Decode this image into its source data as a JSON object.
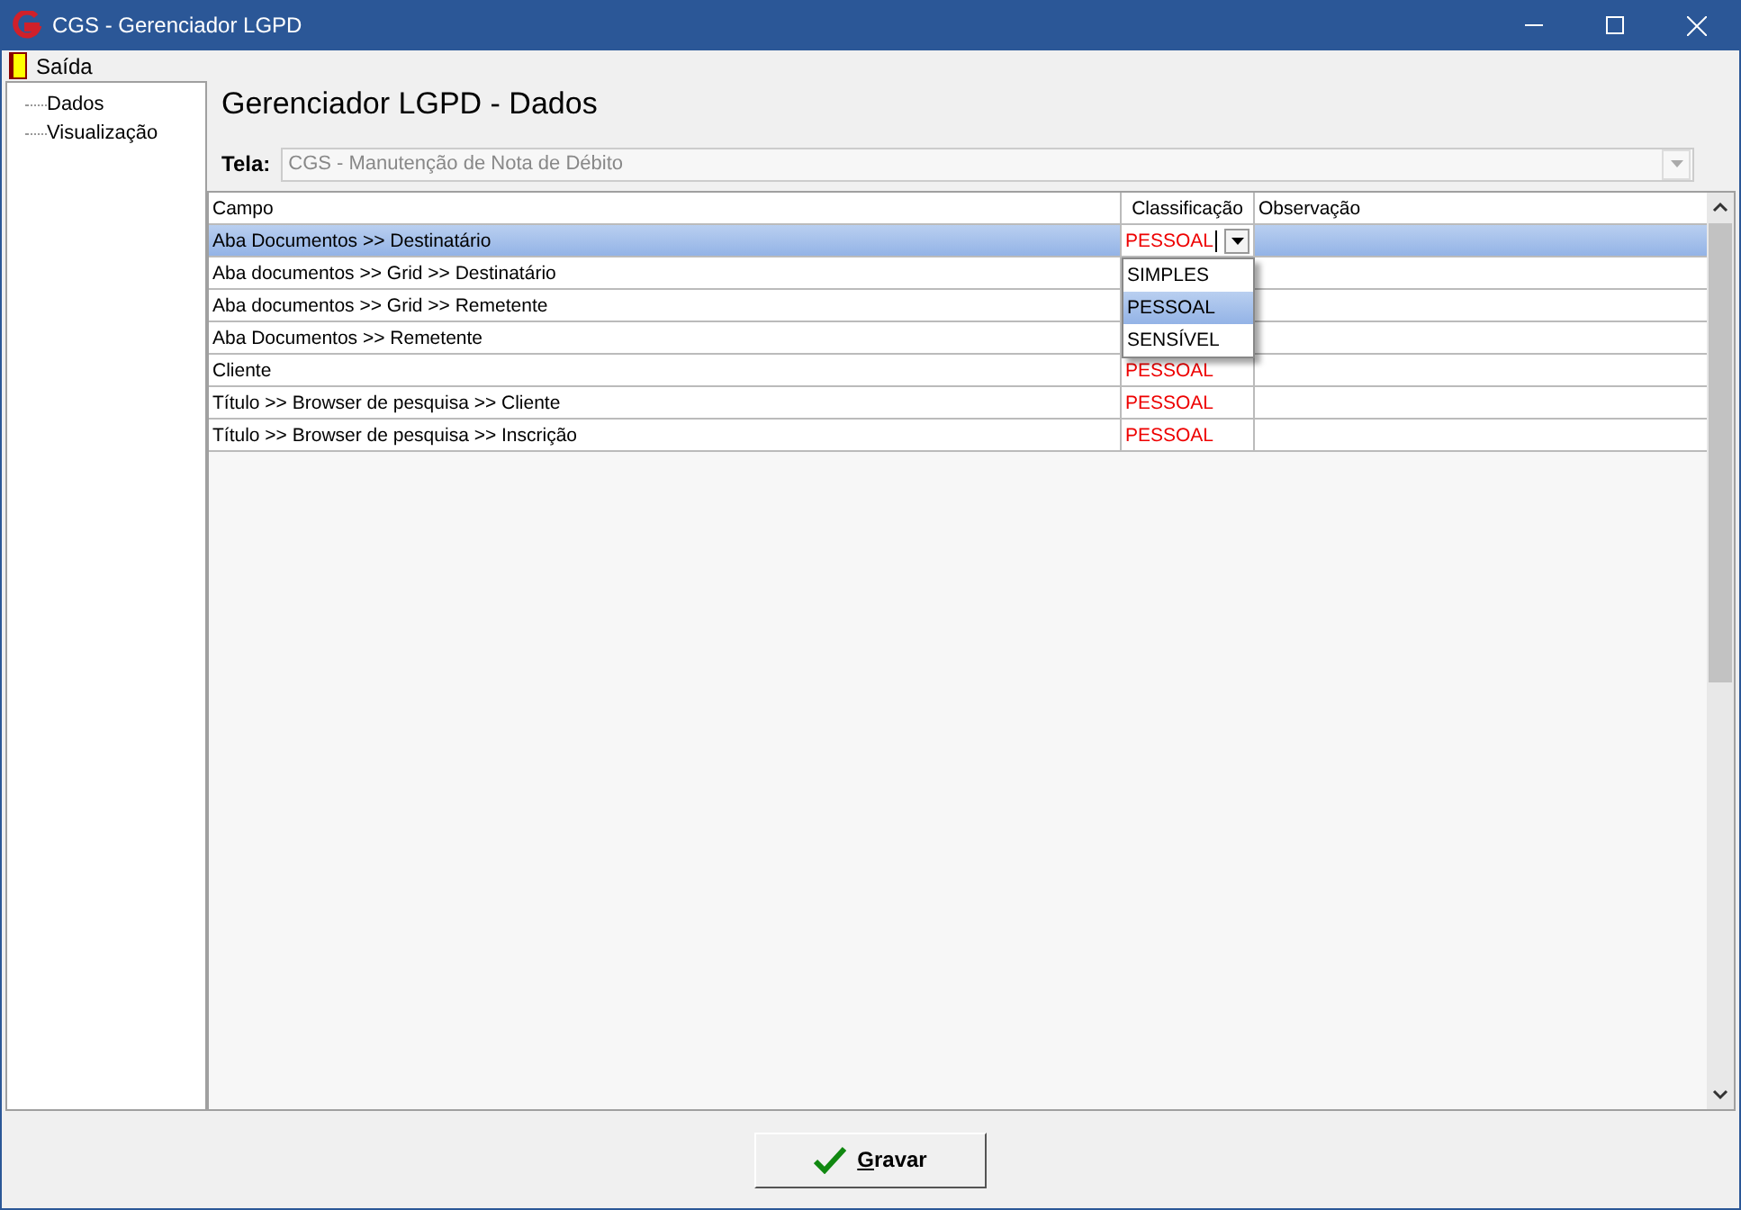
{
  "window": {
    "title": "CGS - Gerenciador LGPD"
  },
  "menu": [
    {
      "label": "Saída"
    }
  ],
  "tree": [
    {
      "label": "Dados"
    },
    {
      "label": "Visualização"
    }
  ],
  "heading": "Gerenciador LGPD - Dados",
  "screen_select": {
    "label": "Tela:",
    "value": "CGS - Manutenção de Nota de Débito",
    "disabled": true
  },
  "table": {
    "columns": [
      "Campo",
      "Classificação",
      "Observação"
    ],
    "rows": [
      {
        "campo": "Aba Documentos >> Destinatário",
        "classificacao": "PESSOAL",
        "selected": true,
        "editing": true
      },
      {
        "campo": "Aba documentos >> Grid  >> Destinatário",
        "selected": false
      },
      {
        "campo": "Aba documentos >> Grid  >> Remetente",
        "selected": false
      },
      {
        "campo": "Aba Documentos >> Remetente",
        "selected": false
      },
      {
        "campo": "Cliente",
        "classificacao": "PESSOAL",
        "selected": false,
        "editing": false
      },
      {
        "campo": "Título >> Browser de pesquisa >> Cliente",
        "classificacao": "PESSOAL",
        "selected": false,
        "editing": false
      },
      {
        "campo": "Título >> Browser de pesquisa >> Inscrição",
        "classificacao": "PESSOAL",
        "selected": false,
        "editing": false
      }
    ]
  },
  "dropdown": {
    "options": [
      {
        "label": "SIMPLES",
        "selected": false
      },
      {
        "label": "PESSOAL",
        "selected": true
      },
      {
        "label": "SENSÍVEL",
        "selected": false
      }
    ]
  },
  "buttons": [
    {
      "label": "Gravar"
    }
  ]
}
